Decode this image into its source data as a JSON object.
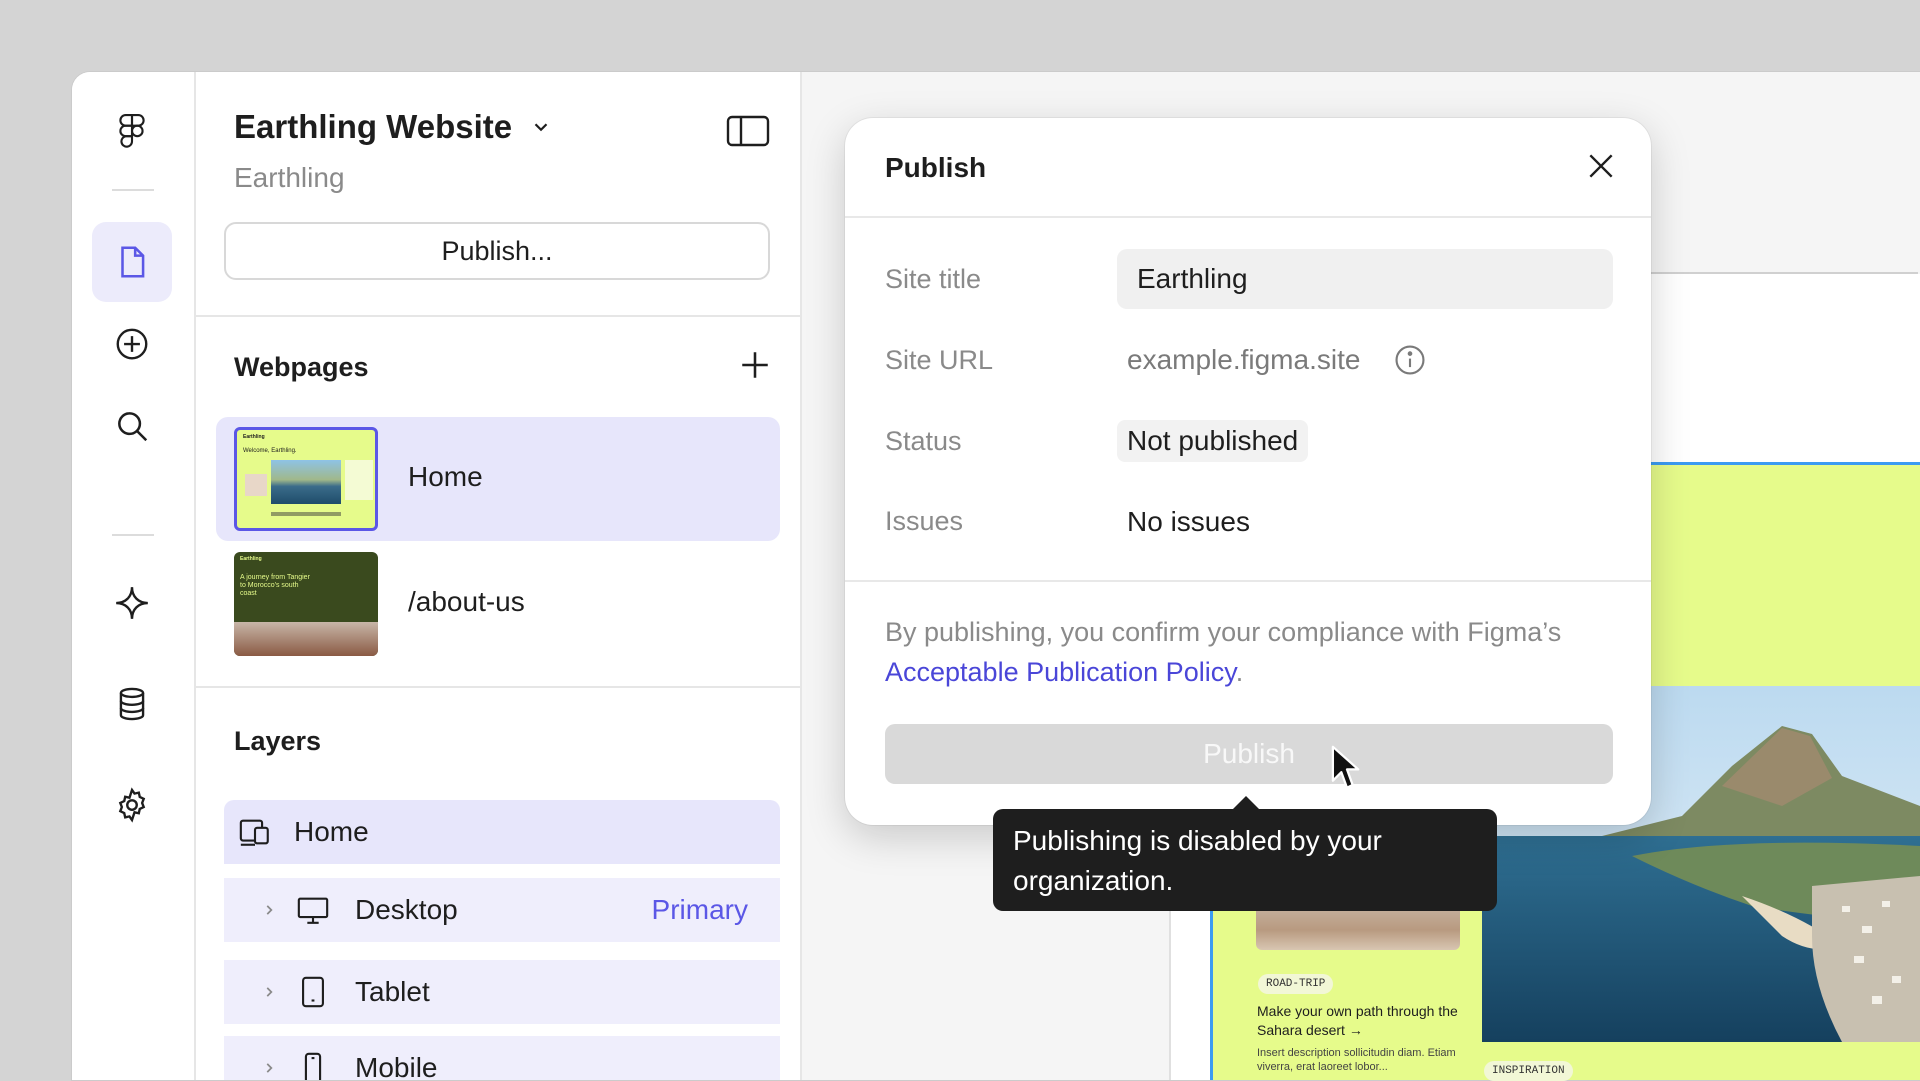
{
  "project": {
    "title": "Earthling Website",
    "team": "Earthling",
    "publish_button": "Publish..."
  },
  "webpages": {
    "heading": "Webpages",
    "items": [
      {
        "label": "Home",
        "active": true
      },
      {
        "label": "/about-us",
        "active": false
      }
    ]
  },
  "layers": {
    "heading": "Layers",
    "items": [
      {
        "label": "Home",
        "icon": "responsive-icon"
      },
      {
        "label": "Desktop",
        "icon": "desktop-icon",
        "tag": "Primary"
      },
      {
        "label": "Tablet",
        "icon": "tablet-icon"
      },
      {
        "label": "Mobile",
        "icon": "mobile-icon"
      }
    ]
  },
  "dialog": {
    "title": "Publish",
    "fields": {
      "site_title_label": "Site title",
      "site_title_value": "Earthling",
      "site_url_label": "Site URL",
      "site_url_value": "example.figma.site",
      "status_label": "Status",
      "status_value": "Not published",
      "issues_label": "Issues",
      "issues_value": "No issues"
    },
    "policy_prefix": "By publishing, you confirm your compliance with Figma’s ",
    "policy_link": "Acceptable Publication Policy",
    "policy_suffix": ".",
    "publish_button": "Publish",
    "tooltip": "Publishing is disabled by your organization."
  },
  "thumbnails": {
    "home_brand": "Earthling",
    "home_heading": "Welcome, Earthling.",
    "about_brand": "Earthling",
    "about_heading": "A journey from Tangier to Morocco's south coast"
  },
  "preview": {
    "tag1": "ROAD-TRIP",
    "card_title": "Make your own path through the Sahara desert →",
    "card_desc": "Insert description sollicitudin diam. Etiam viverra, erat laoreet lobor...",
    "tag2": "INSPIRATION"
  },
  "colors": {
    "accent": "#5b57e6",
    "link": "#4a46d8",
    "selection_bg": "#e7e6fb",
    "preview_bg": "#e6fb8b",
    "tooltip_bg": "#1e1e1e"
  }
}
